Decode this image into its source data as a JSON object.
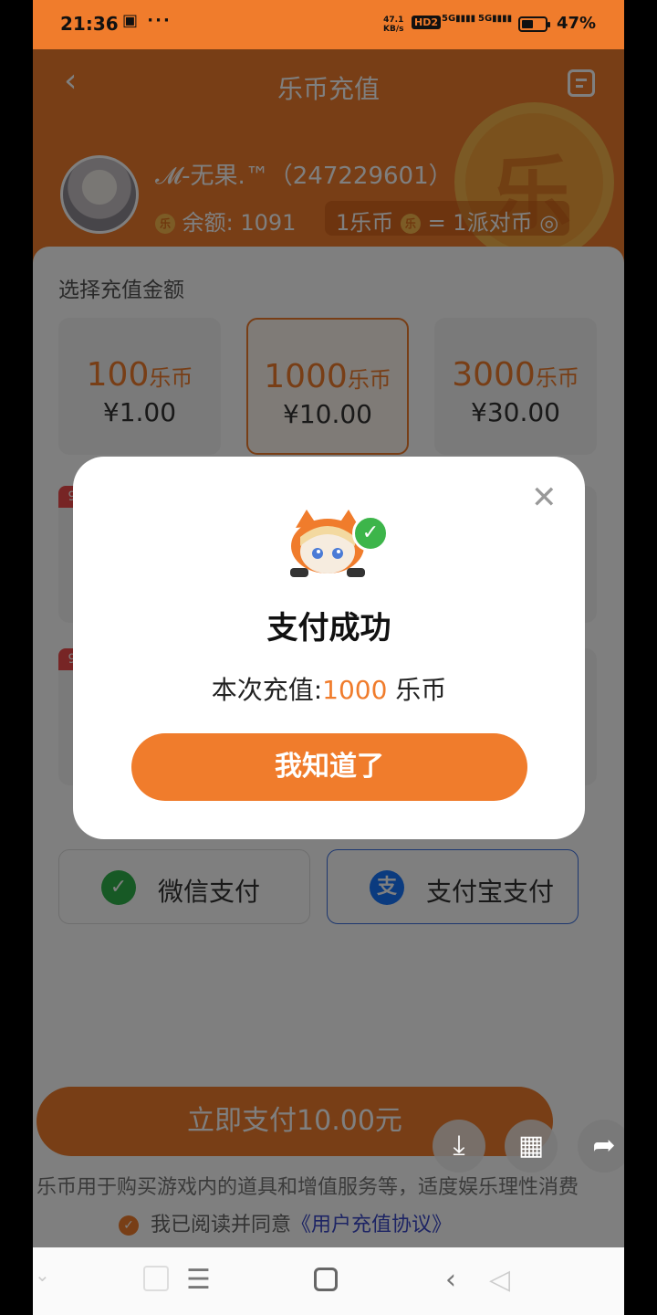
{
  "status_bar": {
    "time": "21:36",
    "speed_value": "47.1",
    "speed_unit": "KB/s",
    "hd": "HD2",
    "sig1": "5G",
    "sig2": "5G",
    "battery": "47%"
  },
  "header": {
    "title": "乐币充值",
    "username": "𝓜-无果.™（247229601）",
    "balance_label": "余额:",
    "balance_value": "1091",
    "rate_left": "1乐币",
    "rate_right": "= 1派对币",
    "coin_glyph": "乐"
  },
  "recharge": {
    "section_title": "选择充值金额",
    "currency_unit": "乐币",
    "options": [
      {
        "coins": "100",
        "price": "¥1.00",
        "selected": false
      },
      {
        "coins": "1000",
        "price": "¥10.00",
        "selected": true
      },
      {
        "coins": "3000",
        "price": "¥30.00",
        "selected": false
      }
    ],
    "promo_badge": "9"
  },
  "payment_methods": {
    "wechat": "微信支付",
    "alipay": "支付宝支付",
    "alipay_glyph": "支"
  },
  "pay_now_label": "立即支付10.00元",
  "tips": "乐币用于购买游戏内的道具和增值服务等，适度娱乐理性消费",
  "agreement": {
    "prefix": "我已阅读并同意",
    "link": "《用户充值协议》"
  },
  "dialog": {
    "title": "支付成功",
    "line_prefix": "本次充值:",
    "line_value": "1000",
    "line_suffix": "乐币",
    "ok_label": "我知道了"
  },
  "colors": {
    "accent": "#f07c2c",
    "success": "#3db54a",
    "link": "#3a49c8"
  }
}
